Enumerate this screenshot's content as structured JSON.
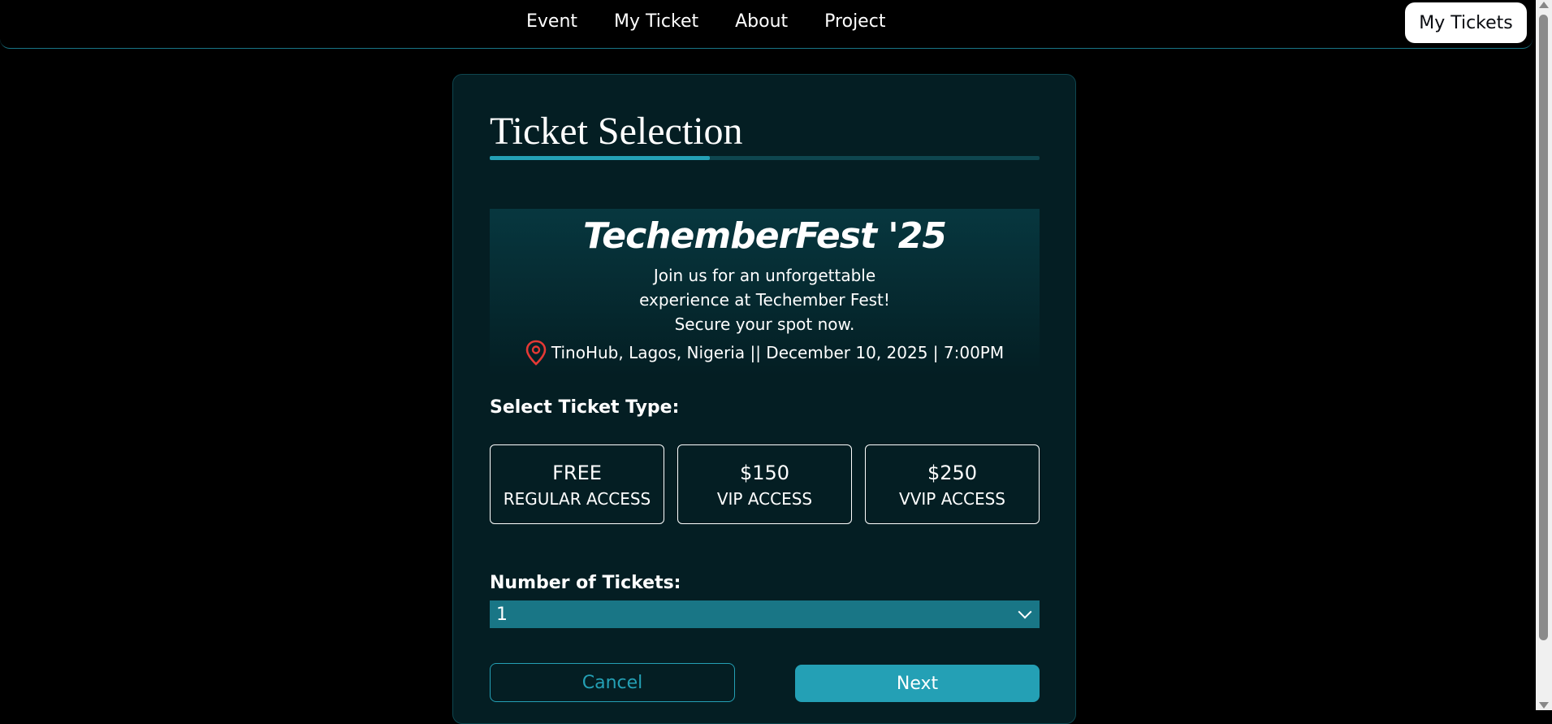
{
  "nav": {
    "links": [
      "Event",
      "My Ticket",
      "About",
      "Project"
    ],
    "button_label": "My Tickets"
  },
  "form": {
    "title": "Ticket Selection",
    "progress": 0.4,
    "event": {
      "name": "TechemberFest '25",
      "description": "Join us for an unforgettable experience at Techember Fest! Secure your spot now.",
      "location_date": "TinoHub, Lagos, Nigeria || December 10, 2025 | 7:00PM",
      "pin_icon": "map-pin-icon"
    },
    "ticket_type_label": "Select Ticket Type:",
    "ticket_types": [
      {
        "price": "FREE",
        "access": "REGULAR ACCESS"
      },
      {
        "price": "$150",
        "access": "VIP ACCESS"
      },
      {
        "price": "$250",
        "access": "VVIP ACCESS"
      }
    ],
    "number_label": "Number of Tickets:",
    "number_value": "1",
    "cancel_label": "Cancel",
    "next_label": "Next"
  },
  "colors": {
    "background": "#000000",
    "card": "#041e23",
    "accent": "#24a0b5",
    "select": "#197686",
    "pin": "#e53935"
  }
}
